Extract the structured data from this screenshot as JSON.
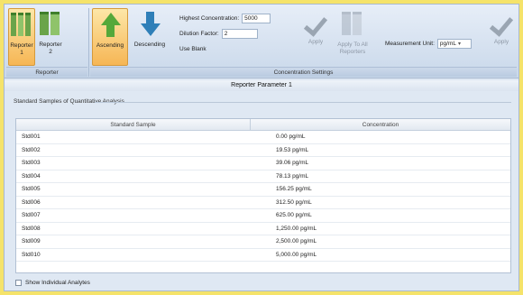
{
  "ribbon": {
    "reporter_1_label": "Reporter 1",
    "reporter_2_label": "Reporter 2",
    "ascending_label": "Ascending",
    "descending_label": "Descending",
    "highest_conc_label": "Highest Concentration:",
    "highest_conc_value": "5000",
    "dilution_label": "Dilution Factor:",
    "dilution_value": "2",
    "use_blank_label": "Use Blank",
    "apply_label": "Apply",
    "apply_all_label": "Apply To All Reporters",
    "unit_label": "Measurement Unit:",
    "unit_value": "pg/mL",
    "apply2_label": "Apply",
    "group_reporter": "Reporter",
    "group_settings": "Concentration Settings"
  },
  "content": {
    "title": "Reporter Parameter 1",
    "section": "Standard Samples of Quantitative Analysis",
    "col_sample": "Standard Sample",
    "col_conc": "Concentration",
    "rows": [
      {
        "sample": "Std001",
        "conc": "0.00 pg/mL"
      },
      {
        "sample": "Std002",
        "conc": "19.53 pg/mL"
      },
      {
        "sample": "Std003",
        "conc": "39.06 pg/mL"
      },
      {
        "sample": "Std004",
        "conc": "78.13 pg/mL"
      },
      {
        "sample": "Std005",
        "conc": "156.25 pg/mL"
      },
      {
        "sample": "Std006",
        "conc": "312.50 pg/mL"
      },
      {
        "sample": "Std007",
        "conc": "625.00 pg/mL"
      },
      {
        "sample": "Std008",
        "conc": "1,250.00 pg/mL"
      },
      {
        "sample": "Std009",
        "conc": "2,500.00 pg/mL"
      },
      {
        "sample": "Std010",
        "conc": "5,000.00 pg/mL"
      }
    ],
    "show_individual": "Show Individual Analytes"
  }
}
